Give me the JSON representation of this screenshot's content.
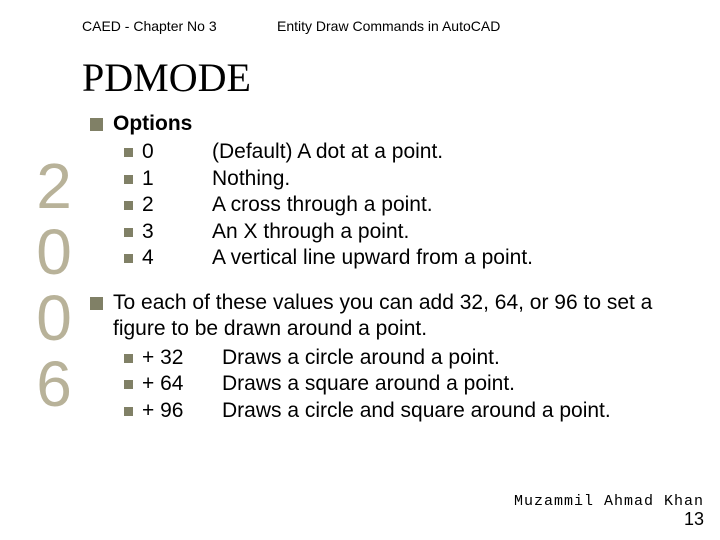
{
  "header": {
    "left": "CAED - Chapter No 3",
    "right": "Entity Draw Commands in AutoCAD"
  },
  "title": "PDMODE",
  "year": "2006",
  "sections": [
    {
      "label": "Options",
      "type": "options",
      "items": [
        {
          "key": "0",
          "desc": "(Default) A dot at a point."
        },
        {
          "key": "1",
          "desc": "Nothing."
        },
        {
          "key": "2",
          "desc": "A cross through a point."
        },
        {
          "key": "3",
          "desc": "An X through a point."
        },
        {
          "key": "4",
          "desc": "A vertical line upward from a point."
        }
      ]
    },
    {
      "text": "To each of these values you can add 32, 64, or 96 to set a figure to be drawn around a point.",
      "type": "para",
      "items": [
        {
          "key": "+ 32",
          "desc": "Draws a circle around a point."
        },
        {
          "key": "+ 64",
          "desc": "Draws a square around a point."
        },
        {
          "key": "+ 96",
          "desc": "Draws a circle and square around a point."
        }
      ]
    }
  ],
  "footer": {
    "author": "Muzammil Ahmad Khan",
    "page": "13"
  }
}
